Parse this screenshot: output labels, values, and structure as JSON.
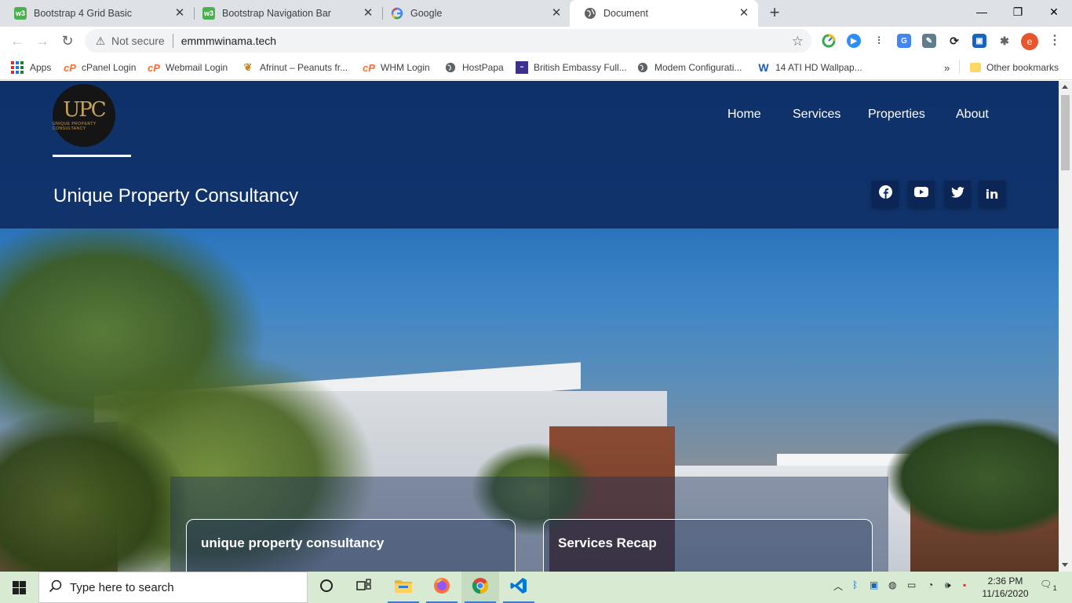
{
  "browser": {
    "tabs": [
      {
        "title": "Bootstrap 4 Grid Basic",
        "favicon": "w3schools-icon",
        "active": false
      },
      {
        "title": "Bootstrap Navigation Bar",
        "favicon": "w3schools-icon",
        "active": false
      },
      {
        "title": "Google",
        "favicon": "google-icon",
        "active": false
      },
      {
        "title": "Document",
        "favicon": "globe-icon",
        "active": true
      }
    ],
    "address": {
      "security": "Not secure",
      "url": "emmmwinama.tech"
    },
    "profile_initial": "e",
    "bookmarks": [
      {
        "label": "Apps"
      },
      {
        "label": "cPanel Login"
      },
      {
        "label": "Webmail Login"
      },
      {
        "label": "Afrinut – Peanuts fr..."
      },
      {
        "label": "WHM Login"
      },
      {
        "label": "HostPapa"
      },
      {
        "label": "British Embassy Full..."
      },
      {
        "label": "Modem Configurati..."
      },
      {
        "label": "14 ATI HD Wallpap..."
      }
    ],
    "other_bookmarks": "Other bookmarks"
  },
  "site": {
    "logo_text": "UPC",
    "logo_subtext": "UNIQUE PROPERTY CONSULTANCY",
    "nav": [
      "Home",
      "Services",
      "Properties",
      "About"
    ],
    "brand": "Unique Property Consultancy",
    "social": [
      "facebook-icon",
      "youtube-icon",
      "twitter-icon",
      "linkedin-icon"
    ],
    "cards": [
      {
        "title": "unique property consultancy"
      },
      {
        "title": "Services Recap"
      }
    ]
  },
  "taskbar": {
    "search_placeholder": "Type here to search",
    "time": "2:36 PM",
    "date": "11/16/2020",
    "notification_count": "1"
  },
  "colors": {
    "header_overlay": "#0e2c64",
    "accent_profile": "#e8552a",
    "taskbar": "#d9ead3"
  }
}
